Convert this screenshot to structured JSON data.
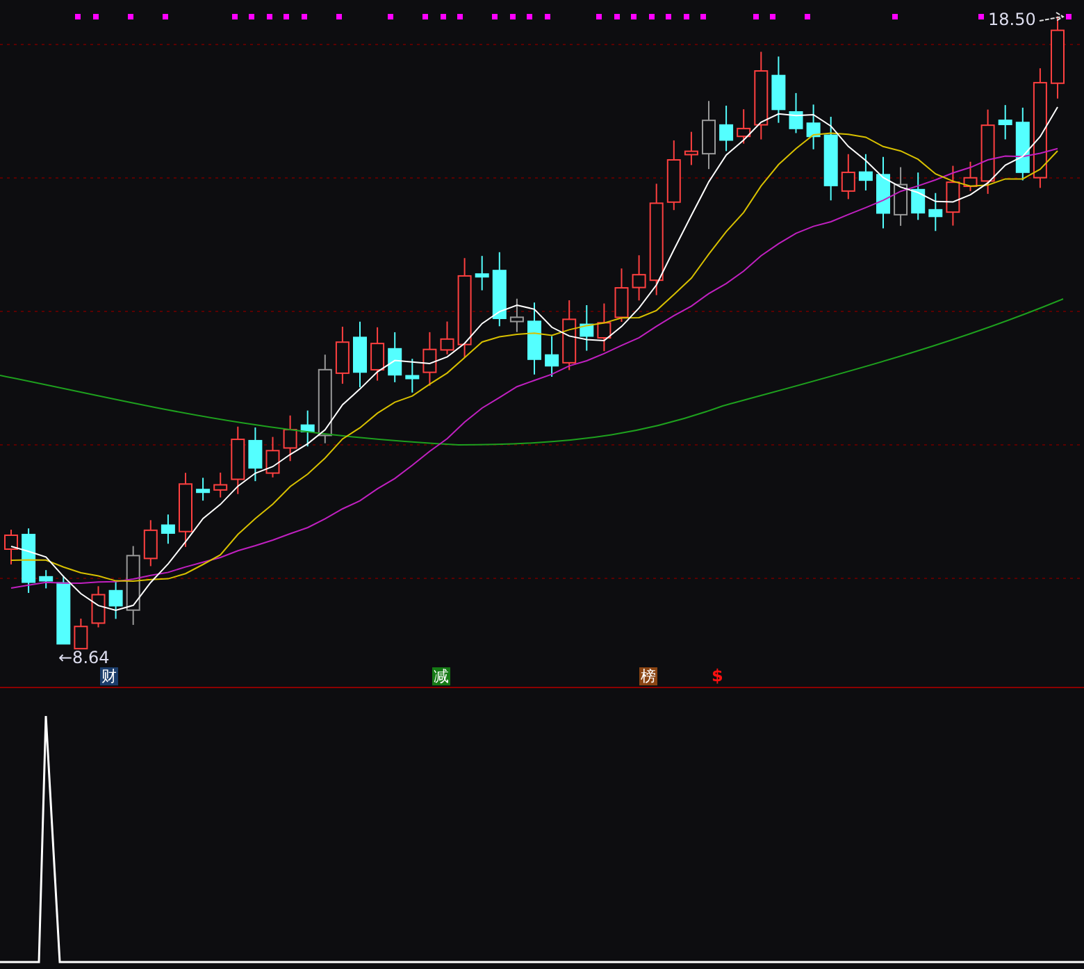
{
  "price_chart": {
    "high_label": "18.50",
    "low_label": "←8.64",
    "markers": [
      {
        "kind": "badge",
        "text": "财",
        "color": "#1b3d6b"
      },
      {
        "kind": "badge",
        "text": "减",
        "color": "#157a15"
      },
      {
        "kind": "badge",
        "text": "榜",
        "color": "#8b4513"
      },
      {
        "kind": "sign",
        "text": "$",
        "color": "#ff1010"
      }
    ]
  }
}
